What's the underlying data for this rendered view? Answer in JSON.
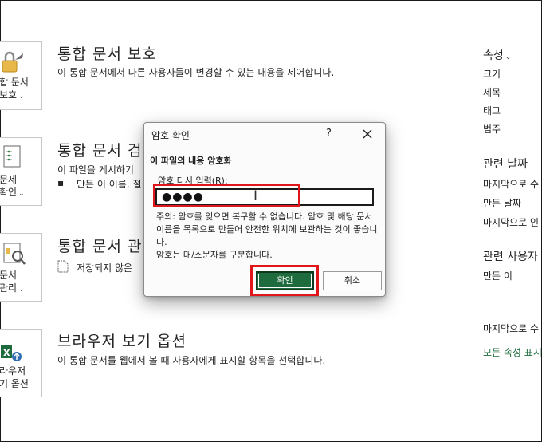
{
  "left_buttons": [
    {
      "line1": "합 문서",
      "line2": "보호"
    },
    {
      "line1": "문제",
      "line2": "확인"
    },
    {
      "line1": "문서",
      "line2": "관리"
    },
    {
      "line1": "라우저",
      "line2": "기 옵션"
    }
  ],
  "sections": [
    {
      "title": "통합 문서 보호",
      "desc": "이 통합 문서에서 다른 사용자들이 변경할 수 있는 내용을 제어합니다."
    },
    {
      "title": "통합 문서 검",
      "desc": "이 파일을 게시하기",
      "sub": "만든 이 이름, 절"
    },
    {
      "title": "통합 문서 관",
      "sub": "저장되지 않은"
    },
    {
      "title": "브라우저 보기 옵션",
      "desc": "이 통합 문서를 웹에서 볼 때 사용자에게 표시할 항목을 선택합니다."
    }
  ],
  "properties": {
    "header": "속성",
    "items": [
      "크기",
      "제목",
      "태그",
      "범주"
    ],
    "dates_header": "관련 날짜",
    "dates": [
      "마지막으로 수",
      "만든 날짜",
      "마지막으로 인"
    ],
    "people_header": "관련 사용자",
    "people": [
      "만든 이"
    ],
    "last_modified_by": "마지막으로 수",
    "show_all_link": "모든 속성 표시"
  },
  "dialog": {
    "title": "암호 확인",
    "help": "?",
    "heading": "이 파일의 내용 암호화",
    "input_label": "암호 다시 입력(R):",
    "password_value": "●●●●",
    "note": "주의: 암호를 잊으면 복구할 수 없습니다. 암호 및 해당 문서 이름을 목록으로 만들어 안전한 위치에 보관하는 것이 좋습니다.",
    "note2": "암호는 대/소문자를 구분합니다.",
    "ok_label": "확인",
    "cancel_label": "취소"
  },
  "colors": {
    "accent": "#1e6b3d",
    "highlight": "#e0161b"
  }
}
